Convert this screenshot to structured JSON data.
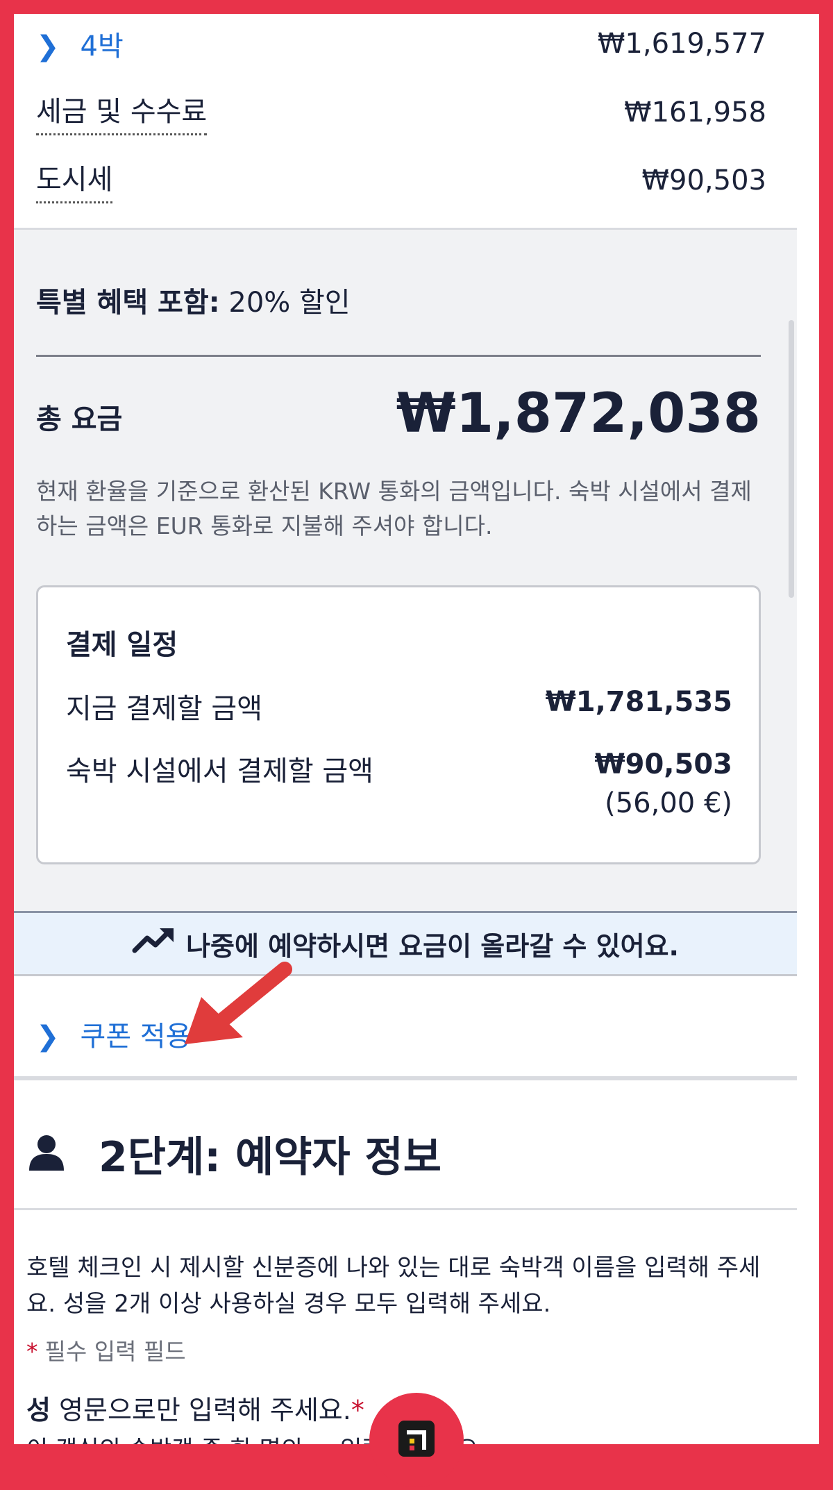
{
  "price_breakdown": {
    "nights_label": "4박",
    "nights_value": "₩1,619,577",
    "taxes_label": "세금 및 수수료",
    "taxes_value": "₩161,958",
    "city_tax_label": "도시세",
    "city_tax_value": "₩90,503"
  },
  "summary": {
    "discount_bold": "특별 혜택 포함:",
    "discount_text": " 20% 할인",
    "total_label": "총 요금",
    "total_value": "₩1,872,038",
    "currency_note": "현재 환율을 기준으로 환산된 KRW 통화의 금액입니다. 숙박 시설에서 결제하는 금액은 EUR 통화로 지불해 주셔야 합니다."
  },
  "payment_schedule": {
    "title": "결제 일정",
    "pay_now_label": "지금 결제할 금액",
    "pay_now_value": "₩1,781,535",
    "pay_at_property_label": "숙박 시설에서 결제할 금액",
    "pay_at_property_value": "₩90,503",
    "pay_at_property_sub": "(56,00 €)"
  },
  "banner": {
    "text": "나중에 예약하시면 요금이 올라갈 수 있어요.",
    "icon": "trending-up-icon"
  },
  "coupon": {
    "label": "쿠폰 적용",
    "icon": "chevron-right-icon"
  },
  "step2": {
    "title": "2단계: 예약자 정보",
    "icon": "person-icon",
    "description": "호텔 체크인 시 제시할 신분증에 나와 있는 대로 숙박객 이름을 입력해 주세요. 성을 2개 이상 사용하실 경우 모두 입력해 주세요.",
    "required_star": "*",
    "required_text": "필수 입력 필드",
    "surname_label": "성",
    "surname_hint": " 영문으로만 입력해 주세요.",
    "partial_text": "이 객실의 숙박객 중 한 명의 ... 입력해 주세요"
  },
  "colors": {
    "frame": "#e8334a",
    "link": "#1f6fd6",
    "text": "#1a2138",
    "banner_bg": "#e9f2fc"
  },
  "fab": {
    "icon": "hotels-logo-icon"
  }
}
